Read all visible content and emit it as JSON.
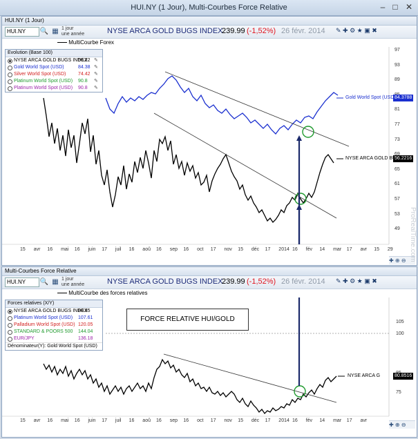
{
  "window": {
    "title": "HUI.NY (1 Jour), Multi-Courbes Force Relative",
    "minimize": "–",
    "maximize": "□",
    "close": "✕"
  },
  "top": {
    "panel_title": "HUI.NY (1 Jour)",
    "symbol": "HUI.NY",
    "period_line1": "1 jour",
    "period_line2": "une année",
    "name": "NYSE ARCA GOLD BUGS INDEX",
    "price": "239.99",
    "change": "(-1,52%)",
    "date": "26 févr. 2014",
    "curve_label": "MultiCourbe Forex",
    "legend": {
      "header": "Evolution (Base 100)",
      "rows": [
        {
          "name": "NYSE ARCA GOLD BUGS INDEX",
          "value": "56.22",
          "color": "#000000",
          "selected": true
        },
        {
          "name": "Gold World Spot (USD)",
          "value": "84.38",
          "color": "#1a2fcf",
          "selected": false
        },
        {
          "name": "Silver World Spot (USD)",
          "value": "74.42",
          "color": "#d21f1f",
          "selected": false
        },
        {
          "name": "Platinum World Spot (USD)",
          "value": "90.8",
          "color": "#1f9a2e",
          "selected": false
        },
        {
          "name": "Platinum World Spot (USD)",
          "value": "90.8",
          "color": "#9b1fa8",
          "selected": false
        }
      ]
    },
    "yticks": [
      "97",
      "93",
      "89",
      "85",
      "81",
      "77",
      "73",
      "69",
      "65",
      "61",
      "57",
      "53",
      "49"
    ],
    "gold_tag": "84.3788",
    "hui_tag": "56.2216",
    "gold_label": "Gold World Spot (USD)",
    "hui_label": "NYSE ARCA GOLD BUG",
    "xticks": [
      "15",
      "avr",
      "16",
      "mai",
      "16",
      "juin",
      "17",
      "juil",
      "16",
      "aoû",
      "16",
      "sep",
      "16",
      "oct",
      "17",
      "nov",
      "15",
      "déc",
      "17",
      "2014",
      "16",
      "fév",
      "14",
      "mar",
      "17",
      "avr",
      "15",
      "29"
    ]
  },
  "bottom": {
    "panel_title": "Multi-Courbes Force Relative",
    "symbol": "HUI.NY",
    "period_line1": "1 jour",
    "period_line2": "une année",
    "name": "NYSE ARCA GOLD BUGS INDEX",
    "price": "239.99",
    "change": "(-1,52%)",
    "date": "26 févr. 2014",
    "curve_label": "MultiCourbe des forces relatives",
    "legend": {
      "header": "Forces relatives (X/Y)",
      "rows": [
        {
          "name": "NYSE ARCA GOLD BUGS INDEX",
          "value": "80.85",
          "color": "#000000",
          "selected": true
        },
        {
          "name": "Platinum World Spot (USD)",
          "value": "107.61",
          "color": "#1a2fcf",
          "selected": false
        },
        {
          "name": "Palladium World Spot (USD)",
          "value": "120.05",
          "color": "#d21f1f",
          "selected": false
        },
        {
          "name": "STANDARD & POORS 500",
          "value": "144.04",
          "color": "#1f9a2e",
          "selected": false
        },
        {
          "name": "EUR/JPY",
          "value": "136.18",
          "color": "#9b1fa8",
          "selected": false
        }
      ],
      "footer": "Dénominateur(Y): Gold World Spot (USD)"
    },
    "annotation": "FORCE RELATIVE HUI/GOLD",
    "yticks": [
      "105",
      "100",
      "85",
      "75"
    ],
    "hui_tag": "80.8516",
    "hui_label": "NYSE ARCA G",
    "xticks": [
      "15",
      "avr",
      "16",
      "mai",
      "16",
      "juin",
      "17",
      "juil",
      "16",
      "aoû",
      "16",
      "sep",
      "16",
      "oct",
      "17",
      "nov",
      "15",
      "déc",
      "17",
      "2014",
      "16",
      "fév",
      "14",
      "mar",
      "17",
      "avr"
    ]
  },
  "watermark": "ProRealTime.com",
  "colors": {
    "gold_line": "#1a2fcf",
    "hui_line": "#000000",
    "circle": "#1f9a2e",
    "arrow": "#1b2a6b",
    "trend": "#333333"
  }
}
